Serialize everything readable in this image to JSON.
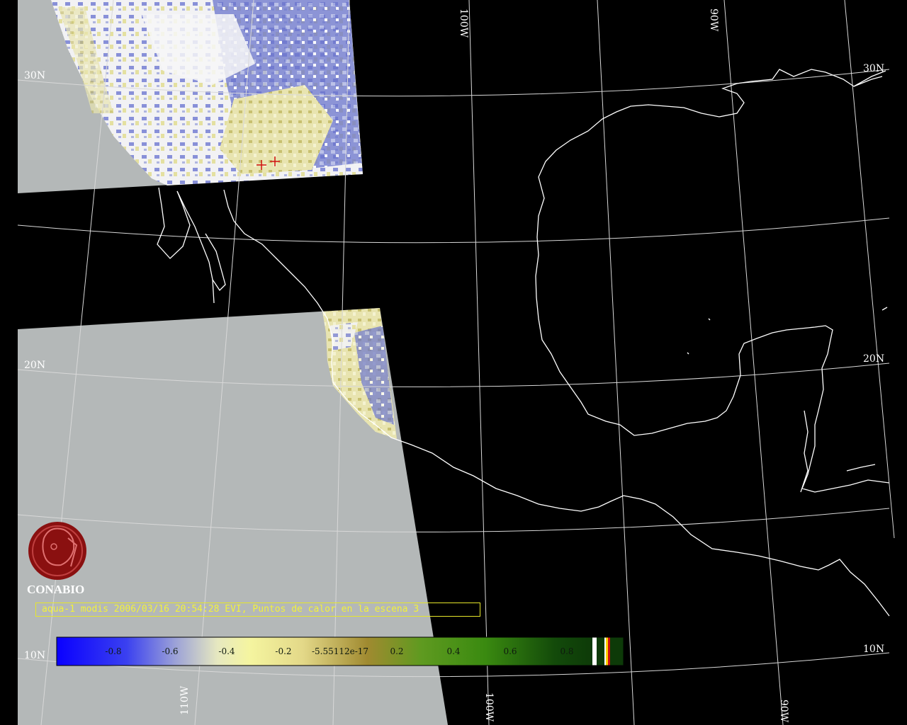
{
  "map": {
    "graticule_labels": {
      "lat": [
        "30N",
        "20N",
        "10N",
        "30N",
        "20N",
        "10N"
      ],
      "lon": [
        "100W",
        "90W",
        "110W",
        "100W",
        "90W"
      ]
    },
    "hotspot_markers": 2
  },
  "logo": {
    "name": "CONABIO"
  },
  "caption": {
    "text": "aqua-1 modis 2006/03/16 20:54:28 EVI, Puntos de calor en la escena 3"
  },
  "colorbar": {
    "labels": [
      "-0.8",
      "-0.6",
      "-0.4",
      "-0.2",
      "-5.55112e-17",
      "0.2",
      "0.4",
      "0.6",
      "0.8"
    ],
    "colors": {
      "blue": "#0a00ff",
      "pale_yellow": "#f5f5a0",
      "olive": "#a08a30",
      "green": "#3a8a10",
      "dark_green": "#0d3a08",
      "hotspot_red": "#d01010",
      "hotspot_yellow": "#ffd000"
    }
  },
  "colors": {
    "background": "#000000",
    "no_data_gray": "#b4b8b8",
    "coastline": "#ffffff",
    "caption": "#f2f23a",
    "logo_red": "#8a1010"
  }
}
